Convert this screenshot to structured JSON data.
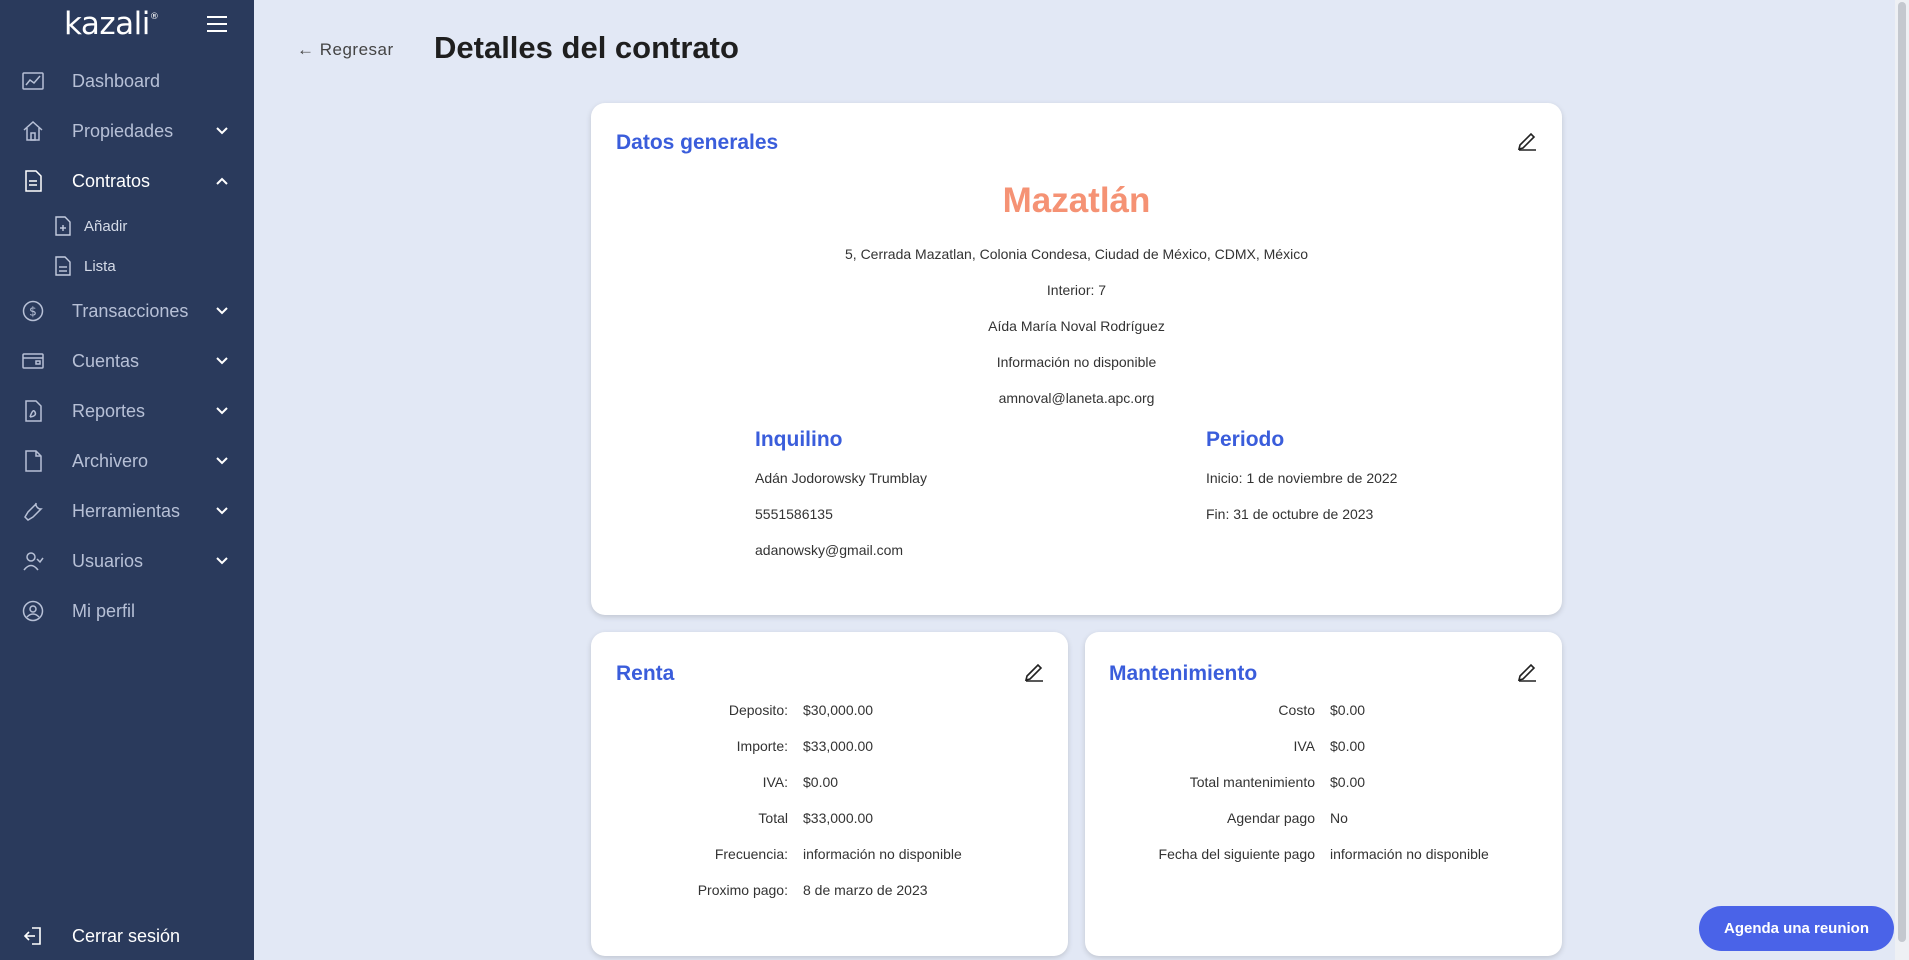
{
  "app": {
    "logo": "kazali",
    "logo_mark": "®"
  },
  "sidebar": {
    "items": [
      {
        "label": "Dashboard",
        "icon": "chart-line-icon"
      },
      {
        "label": "Propiedades",
        "icon": "home-icon"
      },
      {
        "label": "Contratos",
        "icon": "document-icon"
      },
      {
        "label": "Transacciones",
        "icon": "dollar-circle-icon"
      },
      {
        "label": "Cuentas",
        "icon": "wallet-icon"
      },
      {
        "label": "Reportes",
        "icon": "pdf-file-icon"
      },
      {
        "label": "Archivero",
        "icon": "file-icon"
      },
      {
        "label": "Herramientas",
        "icon": "wrench-icon"
      },
      {
        "label": "Usuarios",
        "icon": "users-icon"
      },
      {
        "label": "Mi perfil",
        "icon": "user-circle-icon"
      }
    ],
    "subitems": [
      {
        "label": "Añadir",
        "icon": "file-add-icon"
      },
      {
        "label": "Lista",
        "icon": "file-list-icon"
      }
    ],
    "logout": "Cerrar sesión"
  },
  "header": {
    "back": "← Regresar",
    "title": "Detalles del contrato"
  },
  "general": {
    "title": "Datos generales",
    "property": "Mazatlán",
    "address": "5, Cerrada Mazatlan, Colonia Condesa, Ciudad de México, CDMX, México",
    "interior": "Interior: 7",
    "owner": "Aída María Noval Rodríguez",
    "owner_phone": "Información no disponible",
    "owner_email": "amnoval@laneta.apc.org",
    "tenant": {
      "title": "Inquilino",
      "name": "Adán Jodorowsky Trumblay",
      "phone": "5551586135",
      "email": "adanowsky@gmail.com"
    },
    "period": {
      "title": "Periodo",
      "start": "Inicio: 1 de noviembre de 2022",
      "end": "Fin: 31 de octubre de 2023"
    }
  },
  "rent": {
    "title": "Renta",
    "rows": [
      {
        "key": "Deposito:",
        "value": "$30,000.00"
      },
      {
        "key": "Importe:",
        "value": "$33,000.00"
      },
      {
        "key": "IVA:",
        "value": "$0.00"
      },
      {
        "key": "Total",
        "value": "$33,000.00"
      },
      {
        "key": "Frecuencia:",
        "value": "información no disponible"
      },
      {
        "key": "Proximo pago:",
        "value": "8 de marzo de 2023"
      }
    ]
  },
  "maintenance": {
    "title": "Mantenimiento",
    "rows": [
      {
        "key": "Costo",
        "value": "$0.00"
      },
      {
        "key": "IVA",
        "value": "$0.00"
      },
      {
        "key": "Total mantenimiento",
        "value": "$0.00"
      },
      {
        "key": "Agendar pago",
        "value": "No"
      },
      {
        "key": "Fecha del siguiente pago",
        "value": "información no disponible"
      }
    ]
  },
  "cta": {
    "label": "Agenda una reunion"
  },
  "colors": {
    "sidebar": "#2a3a5c",
    "accent": "#3a5ddb",
    "property": "#f59274",
    "cta": "#4a63e8",
    "background": "#e2e8f5"
  }
}
